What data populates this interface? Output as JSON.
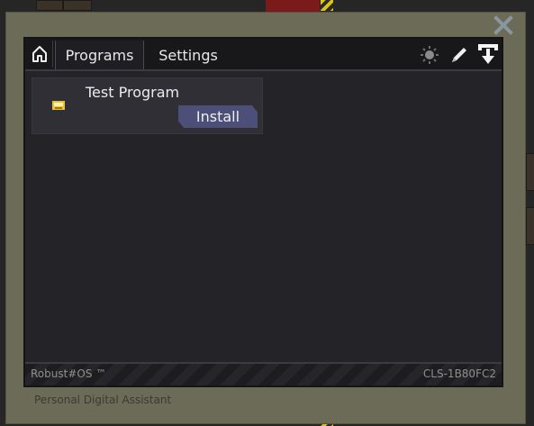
{
  "window": {
    "caption": "Personal Digital Assistant",
    "close_icon": "close-icon"
  },
  "header": {
    "home_icon": "home-icon",
    "tabs": [
      {
        "label": "Programs",
        "active": true
      },
      {
        "label": "Settings",
        "active": false
      }
    ],
    "icons": [
      "brightness-icon",
      "pen-icon",
      "eject-download-icon"
    ]
  },
  "programs": [
    {
      "title": "Test Program",
      "icon": "cartridge-icon",
      "action_label": "Install"
    }
  ],
  "footer": {
    "os_name": "Robust#OS ™",
    "device_id": "CLS-1B80FC2"
  },
  "colors": {
    "frame": "#6b6b58",
    "screen_bg": "#242428",
    "header_bg": "#18181b",
    "card_bg": "#2f2f35",
    "button": "#4c4f78",
    "close": "#8a96a0"
  }
}
